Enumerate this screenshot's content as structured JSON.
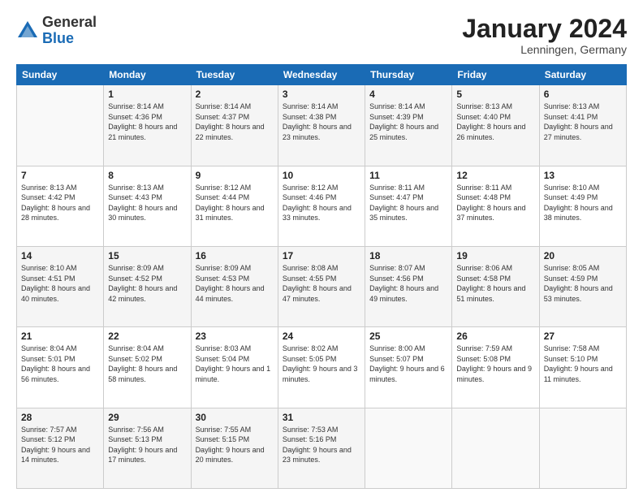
{
  "logo": {
    "general": "General",
    "blue": "Blue"
  },
  "header": {
    "month": "January 2024",
    "location": "Lenningen, Germany"
  },
  "weekdays": [
    "Sunday",
    "Monday",
    "Tuesday",
    "Wednesday",
    "Thursday",
    "Friday",
    "Saturday"
  ],
  "weeks": [
    [
      {
        "day": "",
        "sunrise": "",
        "sunset": "",
        "daylight": ""
      },
      {
        "day": "1",
        "sunrise": "Sunrise: 8:14 AM",
        "sunset": "Sunset: 4:36 PM",
        "daylight": "Daylight: 8 hours and 21 minutes."
      },
      {
        "day": "2",
        "sunrise": "Sunrise: 8:14 AM",
        "sunset": "Sunset: 4:37 PM",
        "daylight": "Daylight: 8 hours and 22 minutes."
      },
      {
        "day": "3",
        "sunrise": "Sunrise: 8:14 AM",
        "sunset": "Sunset: 4:38 PM",
        "daylight": "Daylight: 8 hours and 23 minutes."
      },
      {
        "day": "4",
        "sunrise": "Sunrise: 8:14 AM",
        "sunset": "Sunset: 4:39 PM",
        "daylight": "Daylight: 8 hours and 25 minutes."
      },
      {
        "day": "5",
        "sunrise": "Sunrise: 8:13 AM",
        "sunset": "Sunset: 4:40 PM",
        "daylight": "Daylight: 8 hours and 26 minutes."
      },
      {
        "day": "6",
        "sunrise": "Sunrise: 8:13 AM",
        "sunset": "Sunset: 4:41 PM",
        "daylight": "Daylight: 8 hours and 27 minutes."
      }
    ],
    [
      {
        "day": "7",
        "sunrise": "Sunrise: 8:13 AM",
        "sunset": "Sunset: 4:42 PM",
        "daylight": "Daylight: 8 hours and 28 minutes."
      },
      {
        "day": "8",
        "sunrise": "Sunrise: 8:13 AM",
        "sunset": "Sunset: 4:43 PM",
        "daylight": "Daylight: 8 hours and 30 minutes."
      },
      {
        "day": "9",
        "sunrise": "Sunrise: 8:12 AM",
        "sunset": "Sunset: 4:44 PM",
        "daylight": "Daylight: 8 hours and 31 minutes."
      },
      {
        "day": "10",
        "sunrise": "Sunrise: 8:12 AM",
        "sunset": "Sunset: 4:46 PM",
        "daylight": "Daylight: 8 hours and 33 minutes."
      },
      {
        "day": "11",
        "sunrise": "Sunrise: 8:11 AM",
        "sunset": "Sunset: 4:47 PM",
        "daylight": "Daylight: 8 hours and 35 minutes."
      },
      {
        "day": "12",
        "sunrise": "Sunrise: 8:11 AM",
        "sunset": "Sunset: 4:48 PM",
        "daylight": "Daylight: 8 hours and 37 minutes."
      },
      {
        "day": "13",
        "sunrise": "Sunrise: 8:10 AM",
        "sunset": "Sunset: 4:49 PM",
        "daylight": "Daylight: 8 hours and 38 minutes."
      }
    ],
    [
      {
        "day": "14",
        "sunrise": "Sunrise: 8:10 AM",
        "sunset": "Sunset: 4:51 PM",
        "daylight": "Daylight: 8 hours and 40 minutes."
      },
      {
        "day": "15",
        "sunrise": "Sunrise: 8:09 AM",
        "sunset": "Sunset: 4:52 PM",
        "daylight": "Daylight: 8 hours and 42 minutes."
      },
      {
        "day": "16",
        "sunrise": "Sunrise: 8:09 AM",
        "sunset": "Sunset: 4:53 PM",
        "daylight": "Daylight: 8 hours and 44 minutes."
      },
      {
        "day": "17",
        "sunrise": "Sunrise: 8:08 AM",
        "sunset": "Sunset: 4:55 PM",
        "daylight": "Daylight: 8 hours and 47 minutes."
      },
      {
        "day": "18",
        "sunrise": "Sunrise: 8:07 AM",
        "sunset": "Sunset: 4:56 PM",
        "daylight": "Daylight: 8 hours and 49 minutes."
      },
      {
        "day": "19",
        "sunrise": "Sunrise: 8:06 AM",
        "sunset": "Sunset: 4:58 PM",
        "daylight": "Daylight: 8 hours and 51 minutes."
      },
      {
        "day": "20",
        "sunrise": "Sunrise: 8:05 AM",
        "sunset": "Sunset: 4:59 PM",
        "daylight": "Daylight: 8 hours and 53 minutes."
      }
    ],
    [
      {
        "day": "21",
        "sunrise": "Sunrise: 8:04 AM",
        "sunset": "Sunset: 5:01 PM",
        "daylight": "Daylight: 8 hours and 56 minutes."
      },
      {
        "day": "22",
        "sunrise": "Sunrise: 8:04 AM",
        "sunset": "Sunset: 5:02 PM",
        "daylight": "Daylight: 8 hours and 58 minutes."
      },
      {
        "day": "23",
        "sunrise": "Sunrise: 8:03 AM",
        "sunset": "Sunset: 5:04 PM",
        "daylight": "Daylight: 9 hours and 1 minute."
      },
      {
        "day": "24",
        "sunrise": "Sunrise: 8:02 AM",
        "sunset": "Sunset: 5:05 PM",
        "daylight": "Daylight: 9 hours and 3 minutes."
      },
      {
        "day": "25",
        "sunrise": "Sunrise: 8:00 AM",
        "sunset": "Sunset: 5:07 PM",
        "daylight": "Daylight: 9 hours and 6 minutes."
      },
      {
        "day": "26",
        "sunrise": "Sunrise: 7:59 AM",
        "sunset": "Sunset: 5:08 PM",
        "daylight": "Daylight: 9 hours and 9 minutes."
      },
      {
        "day": "27",
        "sunrise": "Sunrise: 7:58 AM",
        "sunset": "Sunset: 5:10 PM",
        "daylight": "Daylight: 9 hours and 11 minutes."
      }
    ],
    [
      {
        "day": "28",
        "sunrise": "Sunrise: 7:57 AM",
        "sunset": "Sunset: 5:12 PM",
        "daylight": "Daylight: 9 hours and 14 minutes."
      },
      {
        "day": "29",
        "sunrise": "Sunrise: 7:56 AM",
        "sunset": "Sunset: 5:13 PM",
        "daylight": "Daylight: 9 hours and 17 minutes."
      },
      {
        "day": "30",
        "sunrise": "Sunrise: 7:55 AM",
        "sunset": "Sunset: 5:15 PM",
        "daylight": "Daylight: 9 hours and 20 minutes."
      },
      {
        "day": "31",
        "sunrise": "Sunrise: 7:53 AM",
        "sunset": "Sunset: 5:16 PM",
        "daylight": "Daylight: 9 hours and 23 minutes."
      },
      {
        "day": "",
        "sunrise": "",
        "sunset": "",
        "daylight": ""
      },
      {
        "day": "",
        "sunrise": "",
        "sunset": "",
        "daylight": ""
      },
      {
        "day": "",
        "sunrise": "",
        "sunset": "",
        "daylight": ""
      }
    ]
  ]
}
